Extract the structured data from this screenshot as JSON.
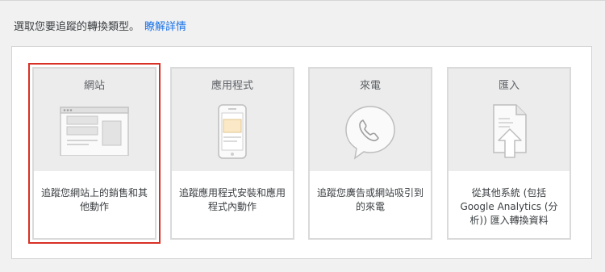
{
  "prompt": {
    "text": "選取您要追蹤的轉換類型。",
    "link": "瞭解詳情"
  },
  "cards": [
    {
      "title": "網站",
      "description": "追蹤您網站上的銷售和其他動作",
      "icon": "website-illustration-icon",
      "selected": true
    },
    {
      "title": "應用程式",
      "description": "追蹤應用程式安裝和應用程式內動作",
      "icon": "mobile-app-illustration-icon",
      "selected": false
    },
    {
      "title": "來電",
      "description": "追蹤您廣告或網站吸引到的來電",
      "icon": "phone-call-illustration-icon",
      "selected": false
    },
    {
      "title": "匯入",
      "description": "從其他系統 (包括 Google Analytics (分析)) 匯入轉換資料",
      "icon": "import-file-illustration-icon",
      "selected": false
    }
  ],
  "colors": {
    "accent_link": "#1a73e8",
    "selection_outline": "#d93025"
  }
}
